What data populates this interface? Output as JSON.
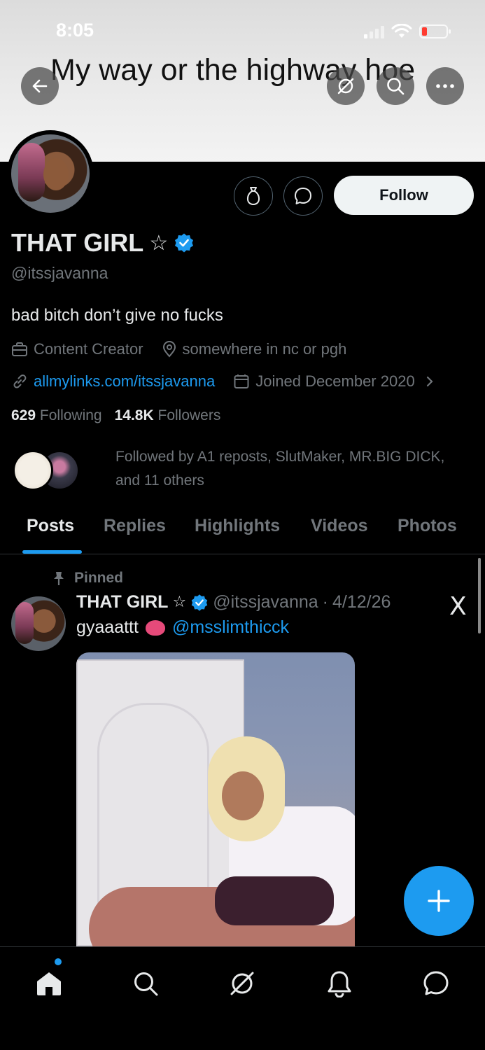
{
  "status_bar": {
    "time": "8:05"
  },
  "banner": {
    "text": "My way or the highway hoe"
  },
  "profile": {
    "name": "THAT GIRL",
    "name_star": "☆",
    "handle": "@itssjavanna",
    "bio": "bad bitch don’t give no fucks",
    "category": "Content Creator",
    "location": "somewhere in nc or pgh",
    "website": "allmylinks.com/itssjavanna",
    "joined": "Joined December 2020",
    "following_count": "629",
    "following_label": "Following",
    "followers_count": "14.8K",
    "followers_label": "Followers",
    "followed_by": "Followed by A1 reposts, SlutMaker, MR.BIG DICK, and 11 others",
    "follow_button": "Follow"
  },
  "tabs": [
    {
      "label": "Posts",
      "active": true
    },
    {
      "label": "Replies",
      "active": false
    },
    {
      "label": "Highlights",
      "active": false
    },
    {
      "label": "Videos",
      "active": false
    },
    {
      "label": "Photos",
      "active": false
    }
  ],
  "post": {
    "pinned_label": "Pinned",
    "author_name": "THAT GIRL",
    "author_star": "☆",
    "author_handle": "@itssjavanna",
    "separator": "·",
    "date": "4/12/26",
    "text": "gyaaattt",
    "mention": "@msslimthicck",
    "source_icon": "X"
  },
  "colors": {
    "accent": "#1d9bf0",
    "background": "#000000",
    "muted_text": "#71767b",
    "primary_text": "#e7e9ea"
  },
  "icons": {
    "header": [
      "back-arrow-icon",
      "grok-icon",
      "search-icon",
      "more-icon"
    ],
    "profile_actions": [
      "money-bag-icon",
      "message-icon"
    ],
    "bottom_nav": [
      "home-icon",
      "search-icon",
      "grok-icon",
      "bell-icon",
      "messages-icon"
    ]
  }
}
